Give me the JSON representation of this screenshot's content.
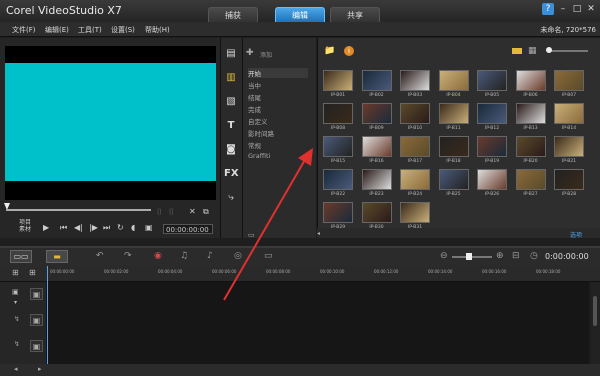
{
  "app": {
    "title": "Corel VideoStudio X7"
  },
  "tabs": [
    {
      "label": "捕获"
    },
    {
      "label": "编辑"
    },
    {
      "label": "共享"
    }
  ],
  "window_buttons": {
    "help": "?",
    "minimize": "–",
    "maximize": "□",
    "close": "✕"
  },
  "menu": [
    {
      "label": "文件(F)"
    },
    {
      "label": "编辑(E)"
    },
    {
      "label": "工具(T)"
    },
    {
      "label": "设置(S)"
    },
    {
      "label": "帮助(H)"
    }
  ],
  "project_info": "未命名, 720*576",
  "preview": {
    "mode_label": "项目\n素材",
    "timecode": "00:00:00:00",
    "screen_color": "#00c1c9"
  },
  "library": {
    "add_label": "添加",
    "categories": [
      {
        "label": "开始"
      },
      {
        "label": "当中"
      },
      {
        "label": "结尾"
      },
      {
        "label": "完成"
      },
      {
        "label": "自定义"
      },
      {
        "label": "影时间路"
      },
      {
        "label": "常规"
      },
      {
        "label": "Graffiti"
      }
    ],
    "thumbnails": [
      {
        "label": "IP-B01"
      },
      {
        "label": "IP-B02"
      },
      {
        "label": "IP-B03"
      },
      {
        "label": "IP-B04"
      },
      {
        "label": "IP-B05"
      },
      {
        "label": "IP-B06"
      },
      {
        "label": "IP-B07"
      },
      {
        "label": "IP-B08"
      },
      {
        "label": "IP-B09"
      },
      {
        "label": "IP-B10"
      },
      {
        "label": "IP-B11"
      },
      {
        "label": "IP-B12"
      },
      {
        "label": "IP-B13"
      },
      {
        "label": "IP-B14"
      },
      {
        "label": "IP-B15"
      },
      {
        "label": "IP-B16"
      },
      {
        "label": "IP-B17"
      },
      {
        "label": "IP-B18"
      },
      {
        "label": "IP-B19"
      },
      {
        "label": "IP-B20"
      },
      {
        "label": "IP-B21"
      },
      {
        "label": "IP-B22"
      },
      {
        "label": "IP-B23"
      },
      {
        "label": "IP-B24"
      },
      {
        "label": "IP-B25"
      },
      {
        "label": "IP-B26"
      },
      {
        "label": "IP-B27"
      },
      {
        "label": "IP-B28"
      },
      {
        "label": "IP-B29"
      },
      {
        "label": "IP-B30"
      },
      {
        "label": "IP-B31"
      }
    ],
    "options_label": "选项"
  },
  "timeline": {
    "timecode": "0:00:00:00",
    "ruler": [
      "00:00:00:00",
      "00:00:02:00",
      "00:00:04:00",
      "00:00:06:00",
      "00:00:08:00",
      "00:00:10:00",
      "00:00:12:00",
      "00:00:14:00",
      "00:00:16:00",
      "00:00:18:00"
    ]
  },
  "colors": {
    "accent": "#2b8ad6",
    "arrow": "#e03030"
  }
}
